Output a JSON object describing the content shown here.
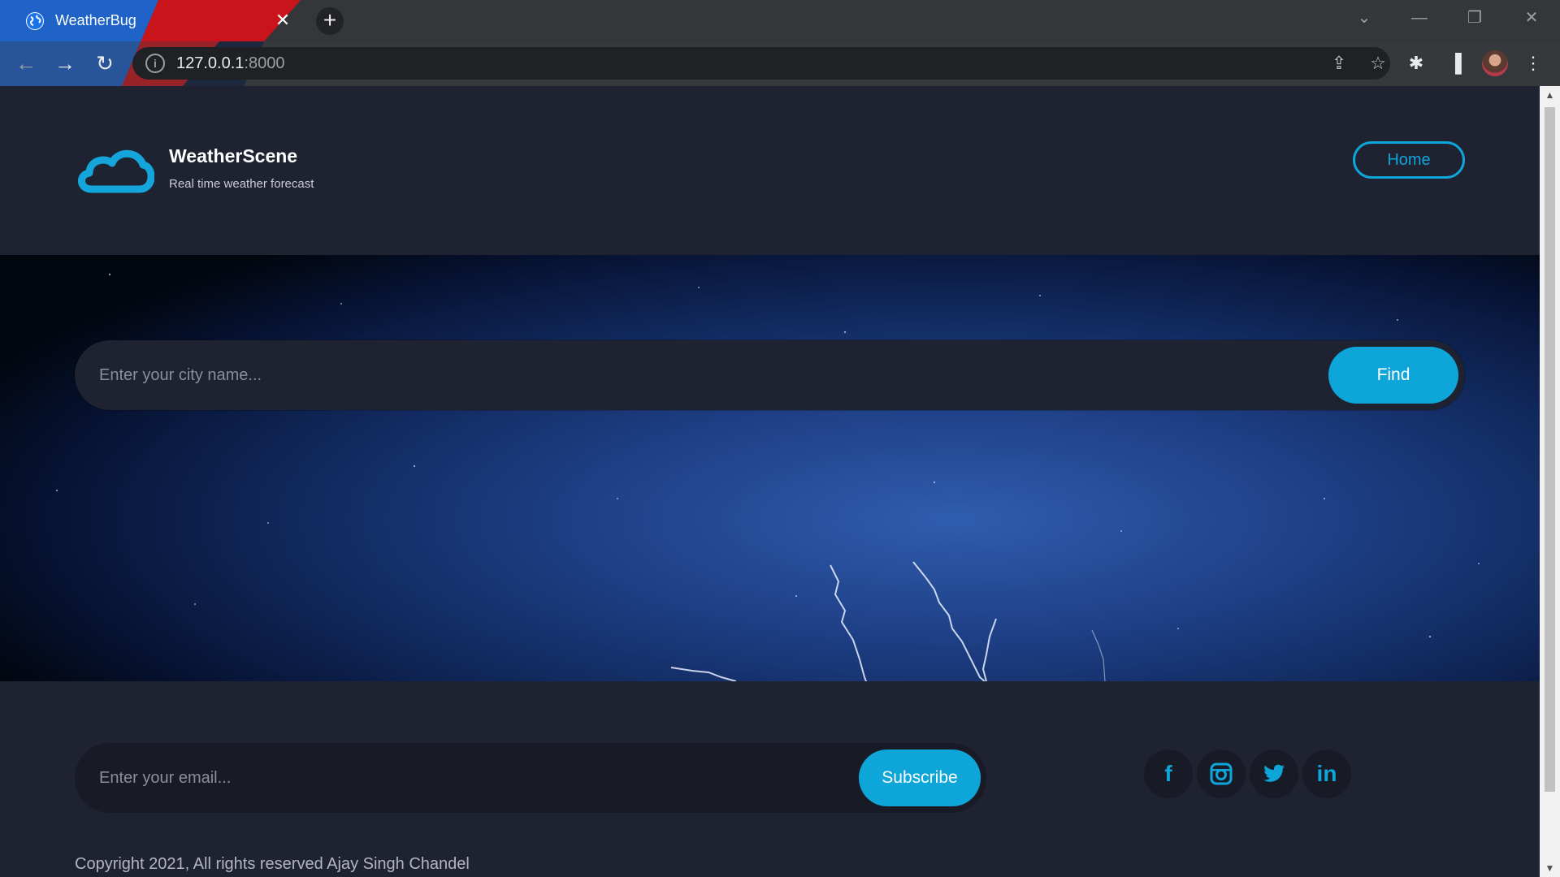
{
  "browser": {
    "tab_title": "WeatherBug",
    "tab_close": "✕",
    "new_tab": "+",
    "url_host": "127.0.0.1",
    "url_port": ":8000",
    "icons": [
      "back-arrow-icon",
      "forward-arrow-icon",
      "reload-icon",
      "info-icon",
      "share-icon",
      "star-icon",
      "extensions-icon",
      "side-panel-icon",
      "profile-avatar",
      "menu-icon"
    ]
  },
  "header": {
    "brand": "WeatherScene",
    "tagline": "Real time weather forecast",
    "home_label": "Home"
  },
  "search": {
    "placeholder": "Enter your city name...",
    "button_label": "Find"
  },
  "footer": {
    "email_placeholder": "Enter your email...",
    "subscribe_label": "Subscribe",
    "social": {
      "facebook": "f",
      "instagram": "◙",
      "twitter": "🐦",
      "linkedin": "in"
    },
    "copyright": "Copyright 2021, All rights reserved Ajay Singh Chandel"
  },
  "colors": {
    "accent": "#0ea5d9",
    "page_bg": "#1f2230",
    "input_bg": "#181b26",
    "chrome_bg": "#35363a"
  }
}
